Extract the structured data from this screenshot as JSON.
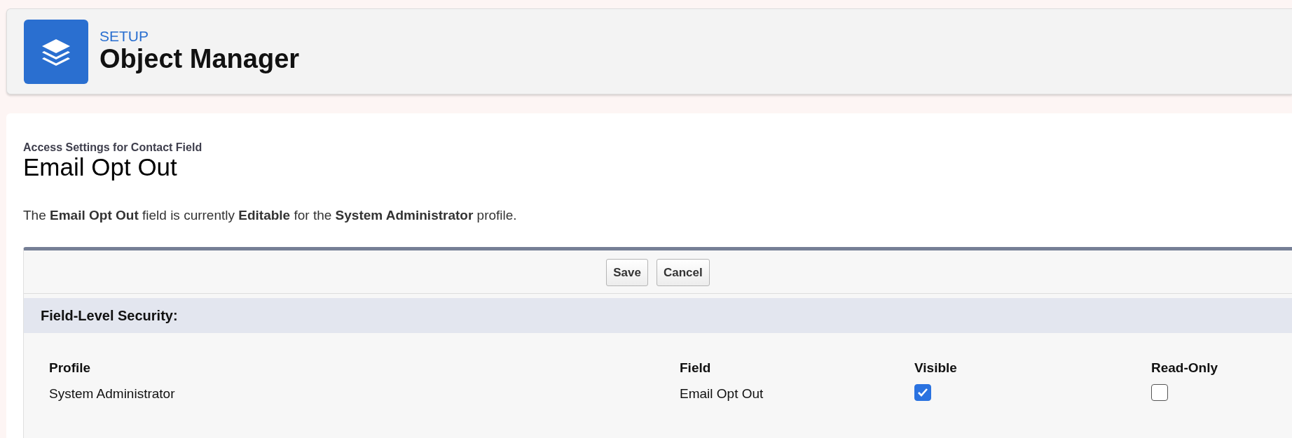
{
  "header": {
    "eyebrow": "SETUP",
    "title": "Object Manager"
  },
  "page": {
    "subtitle": "Access Settings for Contact Field",
    "title": "Email Opt Out",
    "description": "The **Email Opt Out** field is currently **Editable** for the **System Administrator** profile."
  },
  "buttons": [
    "Save",
    "Cancel"
  ],
  "section": {
    "title": "Field-Level Security:"
  },
  "table": {
    "columns": [
      "Profile",
      "Field",
      "Visible",
      "Read-Only"
    ],
    "rows": [
      {
        "profile": "System Administrator",
        "field": "Email Opt Out",
        "visible": {
          "checked": true
        },
        "read_only": {
          "checked": false
        }
      }
    ]
  }
}
